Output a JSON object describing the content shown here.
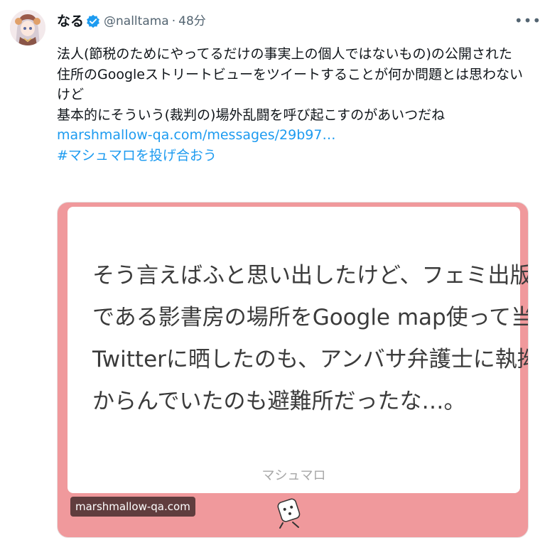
{
  "author": {
    "display_name": "なる",
    "handle": "@nalltama",
    "separator": "·",
    "time": "48分"
  },
  "tweet": {
    "lines": [
      "法人(節税のためにやってるだけの事実上の個人ではないもの)の公開された",
      "住所のGoogleストリートビューをツイートすることが何か問題とは思わない",
      "けど",
      "基本的にそういう(裁判の)場外乱闘を呼び起こすのがあいつだね"
    ],
    "link": "marshmallow-qa.com/messages/29b97…",
    "hashtag": "#マシュマロを投げ合おう"
  },
  "card": {
    "text_lines": [
      "そう言えばふと思い出したけど、フェミ出版社",
      "である影書房の場所をGoogle map使って当時の",
      "Twitterに晒したのも、アンバサ弁護士に執拗に",
      "からんでいたのも避難所だったな…。"
    ],
    "brand": "マシュマロ",
    "domain": "marshmallow-qa.com"
  },
  "icons": {
    "verified": "verified-badge-icon",
    "more": "more-options-icon",
    "mascot": "marshmallow-mascot-icon"
  },
  "colors": {
    "link": "#1d9bf0",
    "card_background": "#f0999c",
    "verified": "#1d9bf0"
  }
}
